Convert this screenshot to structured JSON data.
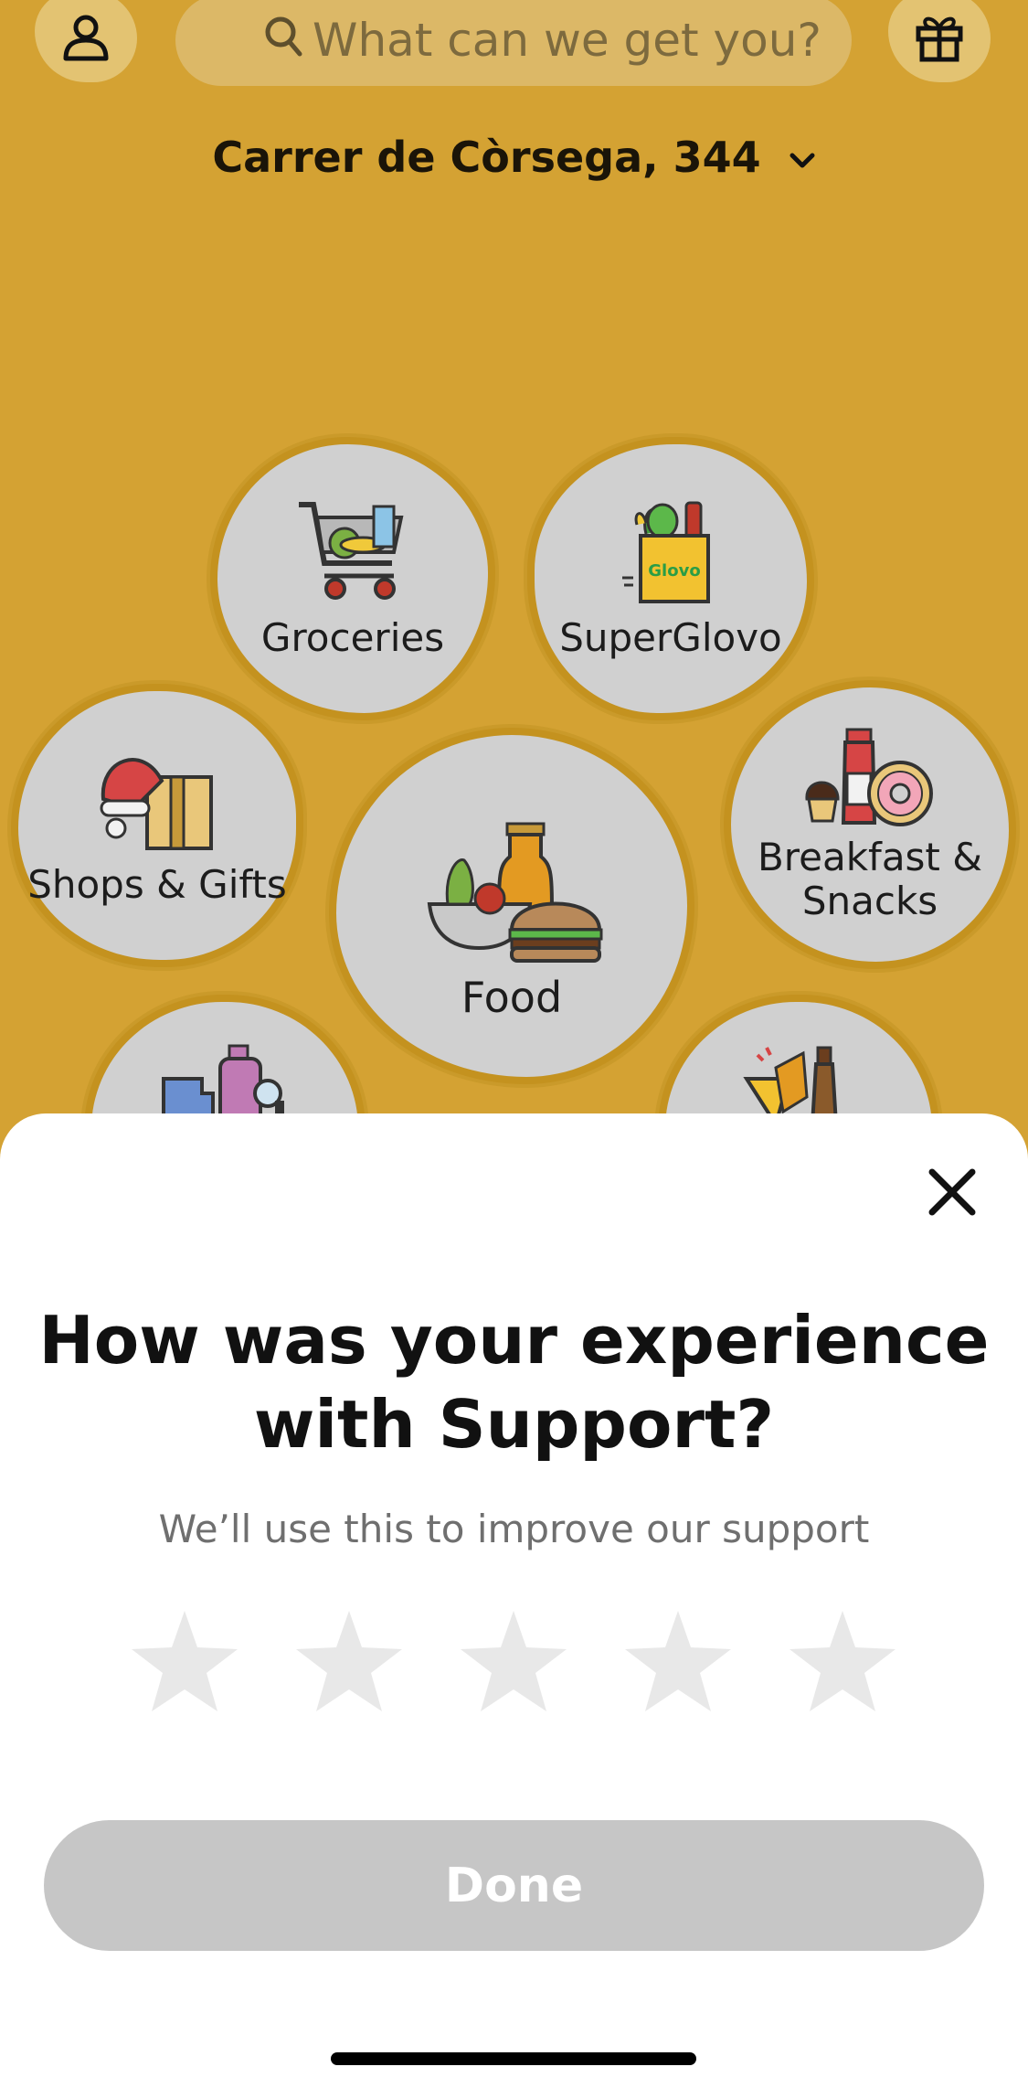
{
  "header": {
    "search_placeholder": "What can we get you?",
    "address": "Carrer de Còrsega, 344"
  },
  "categories": [
    {
      "label": "Groceries"
    },
    {
      "label": "SuperGlovo"
    },
    {
      "label": "Shops & Gifts"
    },
    {
      "label": "Food"
    },
    {
      "label": "Breakfast & Snacks"
    }
  ],
  "rating_sheet": {
    "title_line1": "How was your experience",
    "title_line2": "with Support?",
    "subtitle": "We’ll use this to improve our support",
    "rating": 0,
    "max_rating": 5,
    "done_label": "Done"
  },
  "colors": {
    "background": "#d4a233",
    "bubble": "#d0d0d0",
    "star_empty": "#e8e8e8",
    "done_disabled": "#c6c6c6"
  }
}
